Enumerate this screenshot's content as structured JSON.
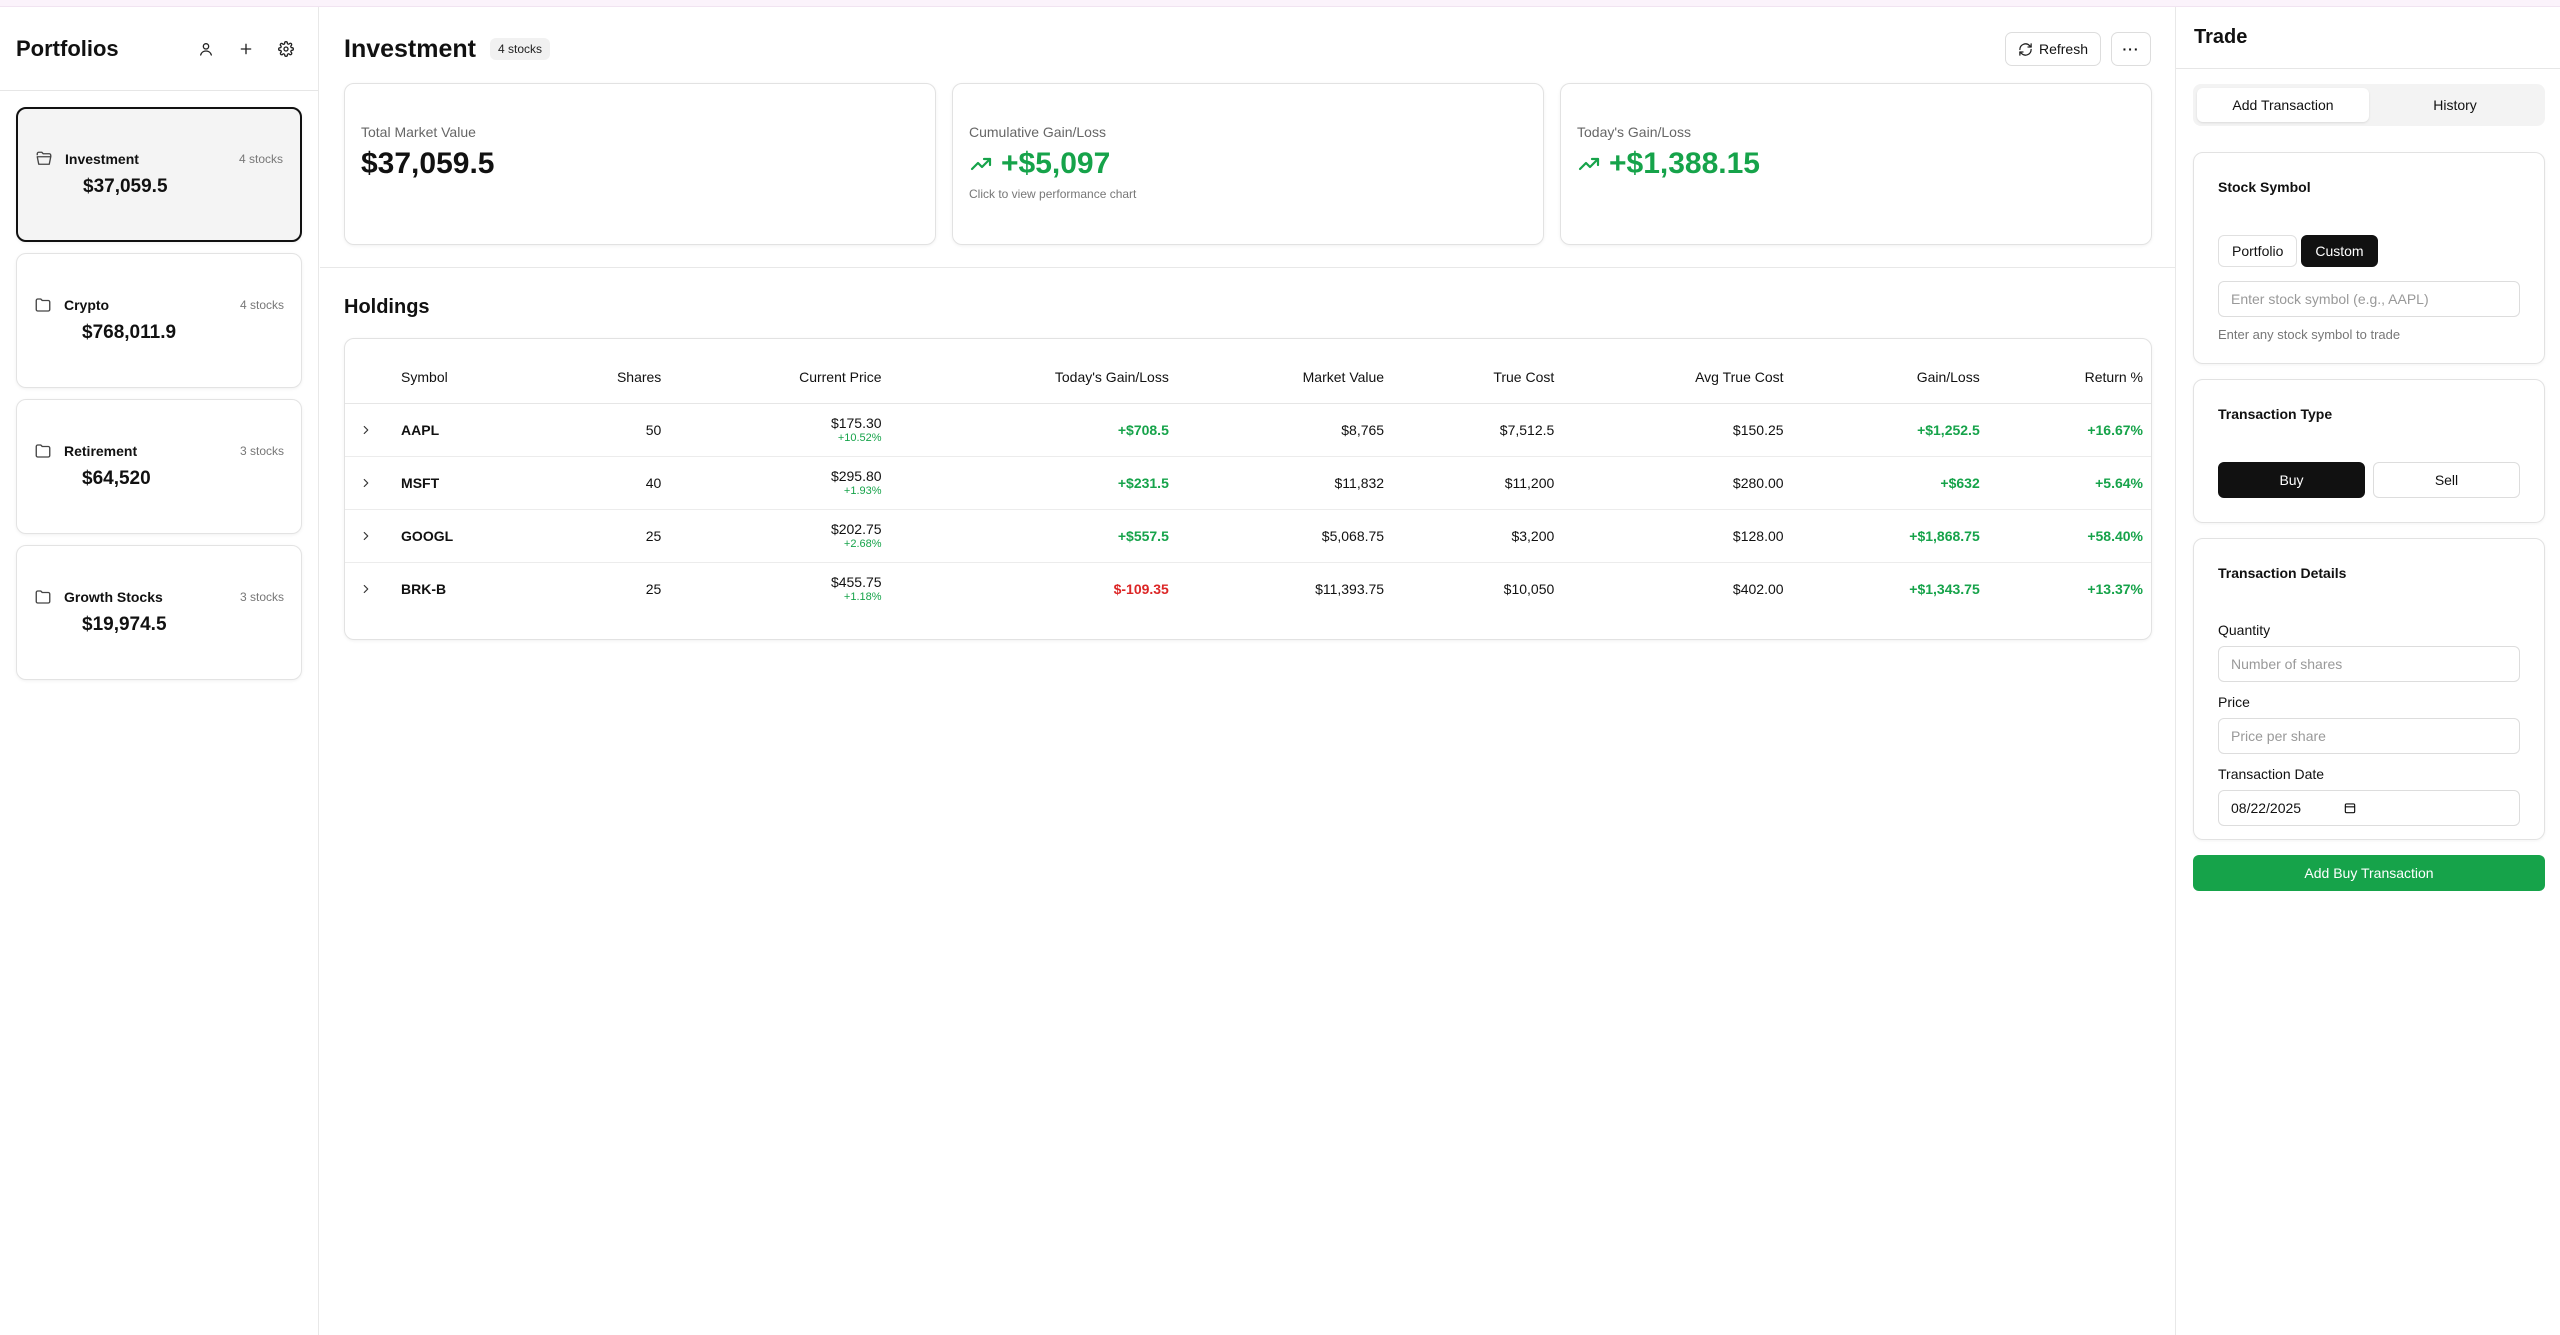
{
  "sidebar": {
    "title": "Portfolios",
    "portfolios": [
      {
        "name": "Investment",
        "count": "4 stocks",
        "value": "$37,059.5"
      },
      {
        "name": "Crypto",
        "count": "4 stocks",
        "value": "$768,011.9"
      },
      {
        "name": "Retirement",
        "count": "3 stocks",
        "value": "$64,520"
      },
      {
        "name": "Growth Stocks",
        "count": "3 stocks",
        "value": "$19,974.5"
      }
    ]
  },
  "main": {
    "title": "Investment",
    "badge": "4 stocks",
    "refresh_label": "Refresh",
    "more_label": "···",
    "stats": {
      "total_label": "Total Market Value",
      "total_value": "$37,059.5",
      "cum_label": "Cumulative Gain/Loss",
      "cum_value": "+$5,097",
      "cum_sub": "Click to view performance chart",
      "today_label": "Today's Gain/Loss",
      "today_value": "+$1,388.15"
    },
    "holdings_title": "Holdings",
    "columns": [
      "Symbol",
      "Shares",
      "Current Price",
      "Today's Gain/Loss",
      "Market Value",
      "True Cost",
      "Avg True Cost",
      "Gain/Loss",
      "Return %"
    ],
    "rows": [
      {
        "symbol": "AAPL",
        "shares": "50",
        "price": "$175.30",
        "price_change": "+10.52%",
        "today": "+$708.5",
        "market": "$8,765",
        "cost": "$7,512.5",
        "avg": "$150.25",
        "gain": "+$1,252.5",
        "ret": "+16.67%"
      },
      {
        "symbol": "MSFT",
        "shares": "40",
        "price": "$295.80",
        "price_change": "+1.93%",
        "today": "+$231.5",
        "market": "$11,832",
        "cost": "$11,200",
        "avg": "$280.00",
        "gain": "+$632",
        "ret": "+5.64%"
      },
      {
        "symbol": "GOOGL",
        "shares": "25",
        "price": "$202.75",
        "price_change": "+2.68%",
        "today": "+$557.5",
        "market": "$5,068.75",
        "cost": "$3,200",
        "avg": "$128.00",
        "gain": "+$1,868.75",
        "ret": "+58.40%"
      },
      {
        "symbol": "BRK-B",
        "shares": "25",
        "price": "$455.75",
        "price_change": "+1.18%",
        "today": "$-109.35",
        "market": "$11,393.75",
        "cost": "$10,050",
        "avg": "$402.00",
        "gain": "+$1,343.75",
        "ret": "+13.37%"
      }
    ]
  },
  "trade": {
    "title": "Trade",
    "tab_add": "Add Transaction",
    "tab_history": "History",
    "symbol_title": "Stock Symbol",
    "seg_portfolio": "Portfolio",
    "seg_custom": "Custom",
    "symbol_placeholder": "Enter stock symbol (e.g., AAPL)",
    "symbol_hint": "Enter any stock symbol to trade",
    "type_title": "Transaction Type",
    "buy_label": "Buy",
    "sell_label": "Sell",
    "details_title": "Transaction Details",
    "quantity_label": "Quantity",
    "quantity_placeholder": "Number of shares",
    "price_label": "Price",
    "price_placeholder": "Price per share",
    "date_label": "Transaction Date",
    "date_value": "08/22/2025",
    "submit_label": "Add Buy Transaction"
  },
  "colors": {
    "green": "#16a34a",
    "red": "#dc2626",
    "dark": "#111111"
  }
}
